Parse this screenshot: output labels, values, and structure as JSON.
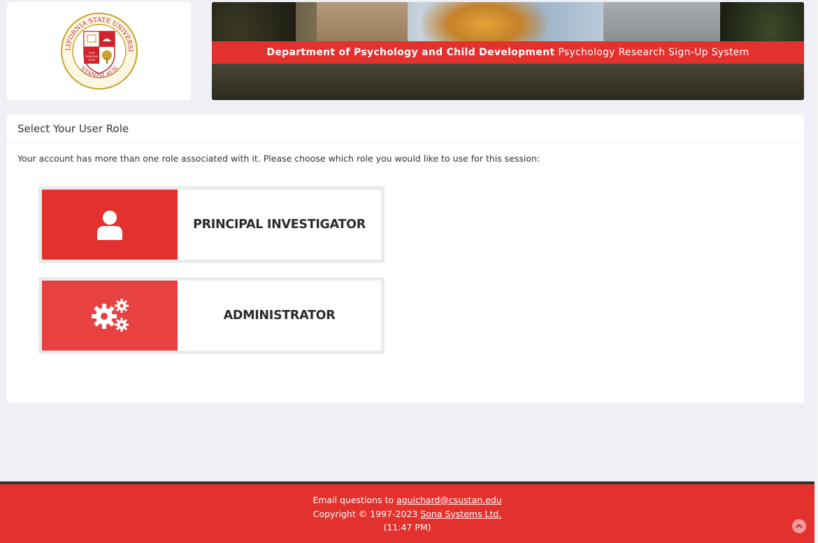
{
  "header": {
    "logo": {
      "ring_text_top": "CALIFORNIA STATE UNIVERSITY",
      "ring_text_bottom": "STANISLAUS",
      "motto": "VOX VERITAS VITA",
      "colors": {
        "gold": "#c9a227",
        "red": "#d2232a"
      }
    },
    "banner": {
      "department": "Department of Psychology and Child Development",
      "system": "Psychology Research Sign-Up System"
    }
  },
  "panel": {
    "title": "Select Your User Role",
    "message": "Your account has more than one role associated with it. Please choose which role you would like to use for this session:",
    "roles": [
      {
        "label": "PRINCIPAL INVESTIGATOR",
        "icon": "user-icon",
        "color": "#e3312d"
      },
      {
        "label": "ADMINISTRATOR",
        "icon": "gears-icon",
        "color": "#e84141"
      }
    ]
  },
  "footer": {
    "email_prefix": "Email questions to ",
    "email": "aguichard@csustan.edu",
    "copyright_prefix": "Copyright © 1997-2023 ",
    "company": "Sona Systems Ltd.",
    "time": "(11:47 PM)",
    "accent": "#e3312d"
  }
}
